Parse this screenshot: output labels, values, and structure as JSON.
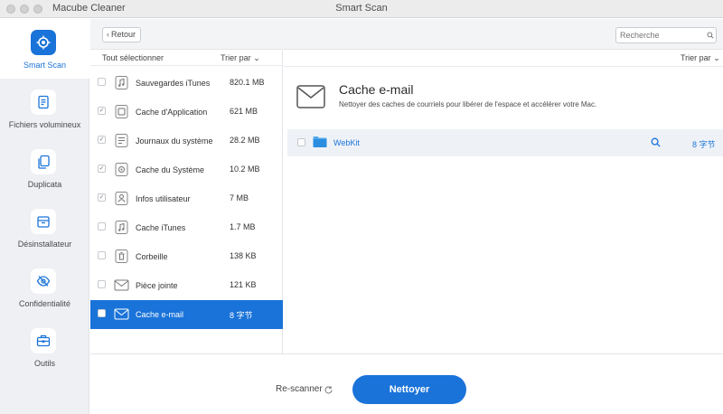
{
  "app_name": "Macube Cleaner",
  "window_title": "Smart Scan",
  "sidebar": {
    "items": [
      {
        "label": "Smart Scan",
        "icon": "target-icon",
        "active": true
      },
      {
        "label": "Fichiers volumineux",
        "icon": "document-icon",
        "active": false
      },
      {
        "label": "Duplicata",
        "icon": "copy-icon",
        "active": false
      },
      {
        "label": "Désinstallateur",
        "icon": "box-icon",
        "active": false
      },
      {
        "label": "Confidentialité",
        "icon": "eye-slash-icon",
        "active": false
      },
      {
        "label": "Outils",
        "icon": "toolbox-icon",
        "active": false
      }
    ]
  },
  "toolbar": {
    "back_label": "Retour",
    "search_placeholder": "Recherche"
  },
  "list": {
    "select_all": "Tout sélectionner",
    "sort_label": "Trier par",
    "items": [
      {
        "name": "Sauvegardes iTunes",
        "size": "820.1 MB",
        "icon": "music-doc-icon",
        "checked": false
      },
      {
        "name": "Cache d'Application",
        "size": "621 MB",
        "icon": "app-cache-icon",
        "checked": true
      },
      {
        "name": "Journaux du système",
        "size": "28.2 MB",
        "icon": "log-icon",
        "checked": true
      },
      {
        "name": "Cache du Système",
        "size": "10.2 MB",
        "icon": "system-cache-icon",
        "checked": true
      },
      {
        "name": "Infos utilisateur",
        "size": "7 MB",
        "icon": "user-info-icon",
        "checked": true
      },
      {
        "name": "Cache iTunes",
        "size": "1.7 MB",
        "icon": "music-doc-icon",
        "checked": false
      },
      {
        "name": "Corbeille",
        "size": "138 KB",
        "icon": "trash-icon",
        "checked": false
      },
      {
        "name": "Pièce jointe",
        "size": "121 KB",
        "icon": "mail-icon",
        "checked": false
      },
      {
        "name": "Cache e-mail",
        "size": "8 字节",
        "icon": "mail-icon",
        "checked": false,
        "selected": true
      }
    ]
  },
  "detail": {
    "sort_label": "Trier par",
    "title": "Cache e-mail",
    "description": "Nettoyer des caches de courriels pour libérer de l'espace et accélérer votre Mac.",
    "files": [
      {
        "name": "WebKit",
        "size": "8 字节"
      }
    ]
  },
  "footer": {
    "rescan_label": "Re-scanner",
    "clean_label": "Nettoyer"
  },
  "colors": {
    "accent": "#1a73d9",
    "sidebar_bg": "#eef0f3"
  }
}
